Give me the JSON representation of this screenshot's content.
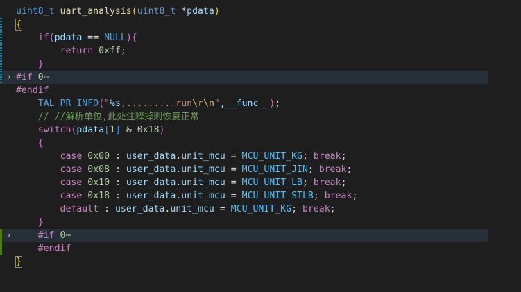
{
  "editor": {
    "lines": [
      {
        "mark": "none",
        "fold": "",
        "highlight": false,
        "tokens": [
          {
            "t": "uint8_t",
            "c": "type"
          },
          {
            "t": " ",
            "c": "punc"
          },
          {
            "t": "uart_analysis",
            "c": "fn"
          },
          {
            "t": "(",
            "c": "b1"
          },
          {
            "t": "uint8_t",
            "c": "type"
          },
          {
            "t": " *",
            "c": "punc"
          },
          {
            "t": "pdata",
            "c": "param"
          },
          {
            "t": ")",
            "c": "b1"
          }
        ]
      },
      {
        "mark": "blue",
        "fold": "",
        "highlight": false,
        "tokens": [
          {
            "t": "{",
            "c": "b1",
            "box": true
          }
        ]
      },
      {
        "mark": "blue",
        "fold": "",
        "highlight": false,
        "tokens": [
          {
            "t": "    ",
            "c": "punc"
          },
          {
            "t": "if",
            "c": "kw"
          },
          {
            "t": "(",
            "c": "b2"
          },
          {
            "t": "pdata",
            "c": "param"
          },
          {
            "t": " == ",
            "c": "punc"
          },
          {
            "t": "NULL",
            "c": "macro"
          },
          {
            "t": ")",
            "c": "b2"
          },
          {
            "t": "{",
            "c": "b2"
          }
        ]
      },
      {
        "mark": "blue",
        "fold": "",
        "highlight": false,
        "tokens": [
          {
            "t": "        ",
            "c": "punc"
          },
          {
            "t": "return",
            "c": "kw"
          },
          {
            "t": " ",
            "c": "punc"
          },
          {
            "t": "0xff",
            "c": "num"
          },
          {
            "t": ";",
            "c": "punc"
          }
        ]
      },
      {
        "mark": "blue",
        "fold": "",
        "highlight": false,
        "tokens": [
          {
            "t": "    ",
            "c": "punc"
          },
          {
            "t": "}",
            "c": "b2"
          }
        ]
      },
      {
        "mark": "blue",
        "fold": "›",
        "highlight": true,
        "tokens": [
          {
            "t": "#if",
            "c": "pre"
          },
          {
            "t": " ",
            "c": "punc"
          },
          {
            "t": "0",
            "c": "num"
          },
          {
            "t": "⋯",
            "c": "ellipsis"
          }
        ]
      },
      {
        "mark": "none",
        "fold": "",
        "highlight": false,
        "tokens": [
          {
            "t": "#endif",
            "c": "pre"
          }
        ]
      },
      {
        "mark": "none",
        "fold": "",
        "highlight": false,
        "tokens": [
          {
            "t": "    ",
            "c": "punc"
          },
          {
            "t": "TAL_PR_INFO",
            "c": "macro"
          },
          {
            "t": "(",
            "c": "b2"
          },
          {
            "t": "\"",
            "c": "str"
          },
          {
            "t": "%s",
            "c": "fmt"
          },
          {
            "t": ",.........run",
            "c": "str"
          },
          {
            "t": "\\r\\n",
            "c": "esc"
          },
          {
            "t": "\"",
            "c": "str"
          },
          {
            "t": ",",
            "c": "punc"
          },
          {
            "t": "__func__",
            "c": "var"
          },
          {
            "t": ")",
            "c": "b2"
          },
          {
            "t": ";",
            "c": "punc"
          }
        ]
      },
      {
        "mark": "none",
        "fold": "",
        "highlight": false,
        "tokens": [
          {
            "t": "    ",
            "c": "punc"
          },
          {
            "t": "// //解析单位,此处注释掉则恢复正常",
            "c": "cmt"
          }
        ]
      },
      {
        "mark": "none",
        "fold": "",
        "highlight": false,
        "tokens": [
          {
            "t": "    ",
            "c": "punc"
          },
          {
            "t": "switch",
            "c": "kw"
          },
          {
            "t": "(",
            "c": "b2"
          },
          {
            "t": "pdata",
            "c": "param"
          },
          {
            "t": "[",
            "c": "b3"
          },
          {
            "t": "1",
            "c": "num"
          },
          {
            "t": "]",
            "c": "b3"
          },
          {
            "t": " & ",
            "c": "punc"
          },
          {
            "t": "0x18",
            "c": "num"
          },
          {
            "t": ")",
            "c": "b2"
          }
        ]
      },
      {
        "mark": "none",
        "fold": "",
        "highlight": false,
        "tokens": [
          {
            "t": "    ",
            "c": "punc"
          },
          {
            "t": "{",
            "c": "b2"
          }
        ]
      },
      {
        "mark": "none",
        "fold": "",
        "highlight": false,
        "tokens": [
          {
            "t": "        ",
            "c": "punc"
          },
          {
            "t": "case",
            "c": "kw"
          },
          {
            "t": " ",
            "c": "punc"
          },
          {
            "t": "0x00",
            "c": "num"
          },
          {
            "t": " : ",
            "c": "punc"
          },
          {
            "t": "user_data",
            "c": "var"
          },
          {
            "t": ".",
            "c": "punc"
          },
          {
            "t": "unit_mcu",
            "c": "var"
          },
          {
            "t": " = ",
            "c": "punc"
          },
          {
            "t": "MCU_UNIT_KG",
            "c": "enum"
          },
          {
            "t": "; ",
            "c": "punc"
          },
          {
            "t": "break",
            "c": "kw"
          },
          {
            "t": ";",
            "c": "punc"
          }
        ]
      },
      {
        "mark": "none",
        "fold": "",
        "highlight": false,
        "tokens": [
          {
            "t": "        ",
            "c": "punc"
          },
          {
            "t": "case",
            "c": "kw"
          },
          {
            "t": " ",
            "c": "punc"
          },
          {
            "t": "0x08",
            "c": "num"
          },
          {
            "t": " : ",
            "c": "punc"
          },
          {
            "t": "user_data",
            "c": "var"
          },
          {
            "t": ".",
            "c": "punc"
          },
          {
            "t": "unit_mcu",
            "c": "var"
          },
          {
            "t": " = ",
            "c": "punc"
          },
          {
            "t": "MCU_UNIT_JIN",
            "c": "enum"
          },
          {
            "t": "; ",
            "c": "punc"
          },
          {
            "t": "break",
            "c": "kw"
          },
          {
            "t": ";",
            "c": "punc"
          }
        ]
      },
      {
        "mark": "none",
        "fold": "",
        "highlight": false,
        "tokens": [
          {
            "t": "        ",
            "c": "punc"
          },
          {
            "t": "case",
            "c": "kw"
          },
          {
            "t": " ",
            "c": "punc"
          },
          {
            "t": "0x10",
            "c": "num"
          },
          {
            "t": " : ",
            "c": "punc"
          },
          {
            "t": "user_data",
            "c": "var"
          },
          {
            "t": ".",
            "c": "punc"
          },
          {
            "t": "unit_mcu",
            "c": "var"
          },
          {
            "t": " = ",
            "c": "punc"
          },
          {
            "t": "MCU_UNIT_LB",
            "c": "enum"
          },
          {
            "t": "; ",
            "c": "punc"
          },
          {
            "t": "break",
            "c": "kw"
          },
          {
            "t": ";",
            "c": "punc"
          }
        ]
      },
      {
        "mark": "none",
        "fold": "",
        "highlight": false,
        "tokens": [
          {
            "t": "        ",
            "c": "punc"
          },
          {
            "t": "case",
            "c": "kw"
          },
          {
            "t": " ",
            "c": "punc"
          },
          {
            "t": "0x18",
            "c": "num"
          },
          {
            "t": " : ",
            "c": "punc"
          },
          {
            "t": "user_data",
            "c": "var"
          },
          {
            "t": ".",
            "c": "punc"
          },
          {
            "t": "unit_mcu",
            "c": "var"
          },
          {
            "t": " = ",
            "c": "punc"
          },
          {
            "t": "MCU_UNIT_STLB",
            "c": "enum"
          },
          {
            "t": "; ",
            "c": "punc"
          },
          {
            "t": "break",
            "c": "kw"
          },
          {
            "t": ";",
            "c": "punc"
          }
        ]
      },
      {
        "mark": "none",
        "fold": "",
        "highlight": false,
        "tokens": [
          {
            "t": "        ",
            "c": "punc"
          },
          {
            "t": "default",
            "c": "kw"
          },
          {
            "t": " : ",
            "c": "punc"
          },
          {
            "t": "user_data",
            "c": "var"
          },
          {
            "t": ".",
            "c": "punc"
          },
          {
            "t": "unit_mcu",
            "c": "var"
          },
          {
            "t": " = ",
            "c": "punc"
          },
          {
            "t": "MCU_UNIT_KG",
            "c": "enum"
          },
          {
            "t": "; ",
            "c": "punc"
          },
          {
            "t": "break",
            "c": "kw"
          },
          {
            "t": ";",
            "c": "punc"
          }
        ]
      },
      {
        "mark": "none",
        "fold": "",
        "highlight": false,
        "tokens": [
          {
            "t": "    ",
            "c": "punc"
          },
          {
            "t": "}",
            "c": "b2"
          }
        ]
      },
      {
        "mark": "green",
        "fold": "›",
        "highlight": true,
        "tokens": [
          {
            "t": "    ",
            "c": "punc"
          },
          {
            "t": "#if",
            "c": "pre"
          },
          {
            "t": " ",
            "c": "punc"
          },
          {
            "t": "0",
            "c": "num"
          },
          {
            "t": "⋯",
            "c": "ellipsis"
          }
        ]
      },
      {
        "mark": "green",
        "fold": "",
        "highlight": false,
        "tokens": [
          {
            "t": "    ",
            "c": "punc"
          },
          {
            "t": "#endif",
            "c": "pre"
          }
        ]
      },
      {
        "mark": "none",
        "fold": "",
        "highlight": false,
        "tokens": [
          {
            "t": "}",
            "c": "b1",
            "box": true
          }
        ]
      }
    ]
  }
}
